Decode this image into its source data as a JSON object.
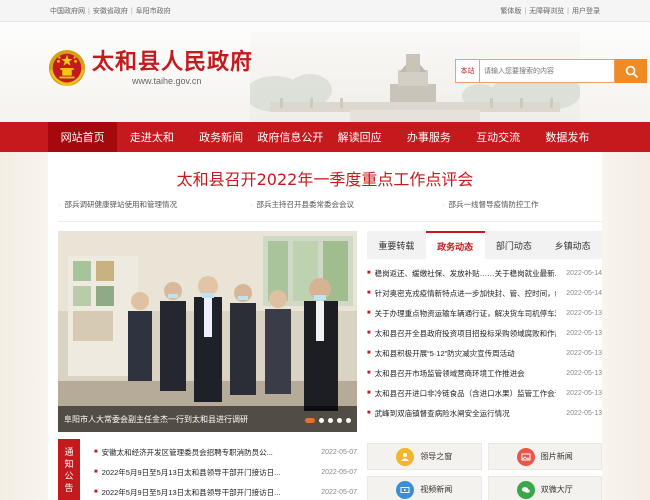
{
  "topbar": {
    "links": [
      "中国政府网",
      "安徽省政府",
      "阜阳市政府"
    ],
    "right": [
      "繁体版",
      "无障碍浏览",
      "用户登录"
    ]
  },
  "header": {
    "title": "太和县人民政府",
    "url": "www.taihe.gov.cn",
    "search_scope": "本站",
    "search_placeholder": "请输入您要搜索的内容"
  },
  "nav": [
    "网站首页",
    "走进太和",
    "政务新闻",
    "政府信息公开",
    "解读回应",
    "办事服务",
    "互动交流",
    "数据发布"
  ],
  "headline": {
    "title": "太和县召开2022年一季度重点工作点评会",
    "links": [
      "邵兵调研健康驿站使用和管理情况",
      "邵兵主持召开县委常委会会议",
      "邵兵一线督导疫情防控工作"
    ]
  },
  "photo": {
    "caption": "阜阳市人大常委会副主任金杰一行到太和县进行调研"
  },
  "news": {
    "tabs": [
      "重要转载",
      "政务动态",
      "部门动态",
      "乡镇动态"
    ],
    "active_tab": 1,
    "items": [
      {
        "title": "稳岗返还、缓缴社保、发放补贴……关于稳岗就业最新...",
        "date": "2022-05-14"
      },
      {
        "title": "针对奥密克戎疫情新特点进一步加快封、管、控时间，缩...",
        "date": "2022-05-14"
      },
      {
        "title": "关于办理重点物资运输车辆通行证，解决货车司机停车难...",
        "date": "2022-05-13"
      },
      {
        "title": "太和县召开全县政府投资项目招投标采购领域腐败和作风...",
        "date": "2022-05-13"
      },
      {
        "title": "太和县积极开展“5·12”防灾减灾宣传周活动",
        "date": "2022-05-13"
      },
      {
        "title": "太和县召开市场监管领域营商环境工作推进会",
        "date": "2022-05-13"
      },
      {
        "title": "太和县召开进口非冷链食品（含进口水果）监管工作会议",
        "date": "2022-05-13"
      },
      {
        "title": "武峰到双庙镇督查病险水闸安全运行情况",
        "date": "2022-05-13"
      }
    ]
  },
  "notice": {
    "label": [
      "通",
      "知",
      "公",
      "告"
    ],
    "items": [
      {
        "title": "安徽太和经济开发区管理委员会招聘专职消防员公...",
        "date": "2022-05-07"
      },
      {
        "title": "2022年5月9日至5月13日太和县领导干部开门接访日...",
        "date": "2022-05-07"
      },
      {
        "title": "2022年5月9日至5月13日太和县领导干部开门接访日...",
        "date": "2022-05-07"
      }
    ]
  },
  "quick": [
    {
      "label": "领导之窗",
      "icon": "leader-icon",
      "color": "#f3b52a"
    },
    {
      "label": "图片新闻",
      "icon": "picture-icon",
      "color": "#e8584a"
    },
    {
      "label": "视频新闻",
      "icon": "video-icon",
      "color": "#3a8fd9"
    },
    {
      "label": "双微大厅",
      "icon": "wechat-icon",
      "color": "#3aa84a"
    }
  ],
  "colors": {
    "brand": "#c41a1e",
    "nav_active": "#a5090d",
    "search_btn": "#f08a24"
  }
}
